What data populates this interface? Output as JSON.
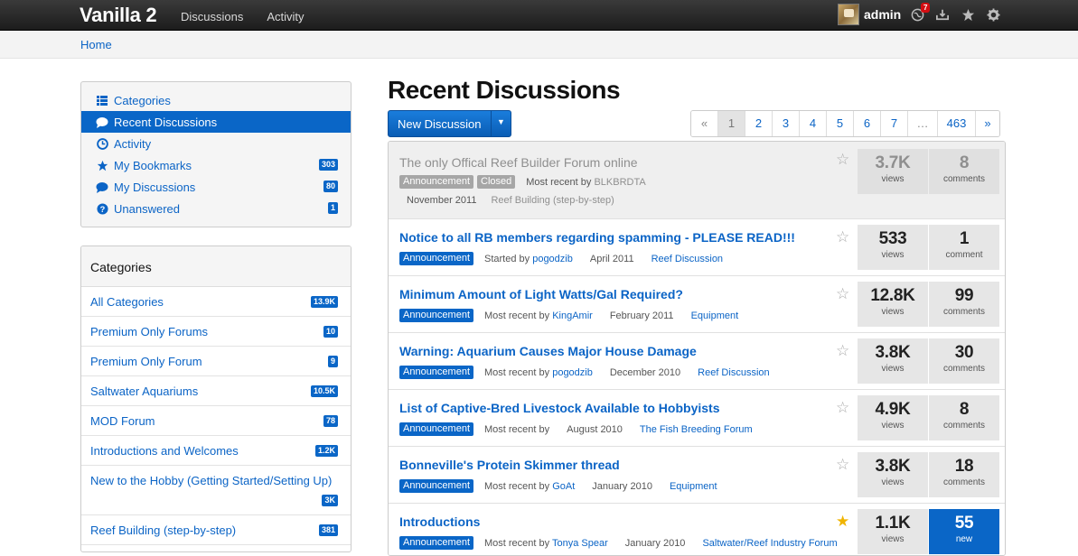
{
  "app": {
    "brand": "Vanilla 2"
  },
  "topnav": [
    "Discussions",
    "Activity"
  ],
  "user": {
    "name": "admin",
    "notifications": "7"
  },
  "breadcrumb": "Home",
  "sidenav": [
    {
      "label": "Categories",
      "icon": "list-icon",
      "count": ""
    },
    {
      "label": "Recent Discussions",
      "icon": "chat-bubble-icon",
      "count": "",
      "active": true
    },
    {
      "label": "Activity",
      "icon": "clock-icon",
      "count": ""
    },
    {
      "label": "My Bookmarks",
      "icon": "star-icon",
      "count": "303"
    },
    {
      "label": "My Discussions",
      "icon": "chat-bubble-icon",
      "count": "80"
    },
    {
      "label": "Unanswered",
      "icon": "question-icon",
      "count": "1"
    }
  ],
  "categories": {
    "title": "Categories",
    "items": [
      {
        "label": "All Categories",
        "count": "13.9K"
      },
      {
        "label": "Premium Only Forums",
        "count": "10"
      },
      {
        "label": "Premium Only Forum",
        "count": "9"
      },
      {
        "label": "Saltwater Aquariums",
        "count": "10.5K"
      },
      {
        "label": "MOD Forum",
        "count": "78"
      },
      {
        "label": "Introductions and Welcomes",
        "count": "1.2K"
      },
      {
        "label": "New to the Hobby (Getting Started/Setting Up)",
        "count": "3K"
      },
      {
        "label": "Reef Building (step-by-step)",
        "count": "381"
      }
    ]
  },
  "main": {
    "title": "Recent Discussions",
    "new_button": "New Discussion",
    "pager": [
      "«",
      "1",
      "2",
      "3",
      "4",
      "5",
      "6",
      "7",
      "…",
      "463",
      "»"
    ],
    "current_page": "1"
  },
  "discussions": [
    {
      "title": "The only Offical Reef Builder Forum online",
      "tags": [
        "Announcement",
        "Closed"
      ],
      "meta_prefix": "Most recent by",
      "author": "BLKBRDTA",
      "date": "November 2011",
      "category": "Reef Building (step-by-step)",
      "views": "3.7K",
      "views_label": "views",
      "comments": "8",
      "comments_label": "comments",
      "starred": false,
      "closed": true
    },
    {
      "title": "Notice to all RB members regarding spamming - PLEASE READ!!!",
      "tags": [
        "Announcement"
      ],
      "meta_prefix": "Started by",
      "author": "pogodzib",
      "date": "April 2011",
      "category": "Reef Discussion",
      "views": "533",
      "views_label": "views",
      "comments": "1",
      "comments_label": "comment",
      "starred": false
    },
    {
      "title": "Minimum Amount of Light Watts/Gal Required?",
      "tags": [
        "Announcement"
      ],
      "meta_prefix": "Most recent by",
      "author": "KingAmir",
      "date": "February 2011",
      "category": "Equipment",
      "views": "12.8K",
      "views_label": "views",
      "comments": "99",
      "comments_label": "comments",
      "starred": false
    },
    {
      "title": "Warning: Aquarium Causes Major House Damage",
      "tags": [
        "Announcement"
      ],
      "meta_prefix": "Most recent by",
      "author": "pogodzib",
      "date": "December 2010",
      "category": "Reef Discussion",
      "views": "3.8K",
      "views_label": "views",
      "comments": "30",
      "comments_label": "comments",
      "starred": false
    },
    {
      "title": "List of Captive-Bred Livestock Available to Hobbyists",
      "tags": [
        "Announcement"
      ],
      "meta_prefix": "Most recent by",
      "author": "",
      "date": "August 2010",
      "category": "The Fish Breeding Forum",
      "views": "4.9K",
      "views_label": "views",
      "comments": "8",
      "comments_label": "comments",
      "starred": false
    },
    {
      "title": "Bonneville's Protein Skimmer thread",
      "tags": [
        "Announcement"
      ],
      "meta_prefix": "Most recent by",
      "author": "GoAt",
      "date": "January 2010",
      "category": "Equipment",
      "views": "3.8K",
      "views_label": "views",
      "comments": "18",
      "comments_label": "comments",
      "starred": false
    },
    {
      "title": "Introductions",
      "tags": [
        "Announcement"
      ],
      "meta_prefix": "Most recent by",
      "author": "Tonya Spear",
      "date": "January 2010",
      "category": "Saltwater/Reef Industry Forum",
      "views": "1.1K",
      "views_label": "views",
      "comments": "55",
      "comments_label": "new",
      "starred": true,
      "new": true
    }
  ],
  "colors": {
    "accent": "#0a66c7",
    "topbar": "#2a2a2a",
    "star_on": "#f0b400"
  }
}
